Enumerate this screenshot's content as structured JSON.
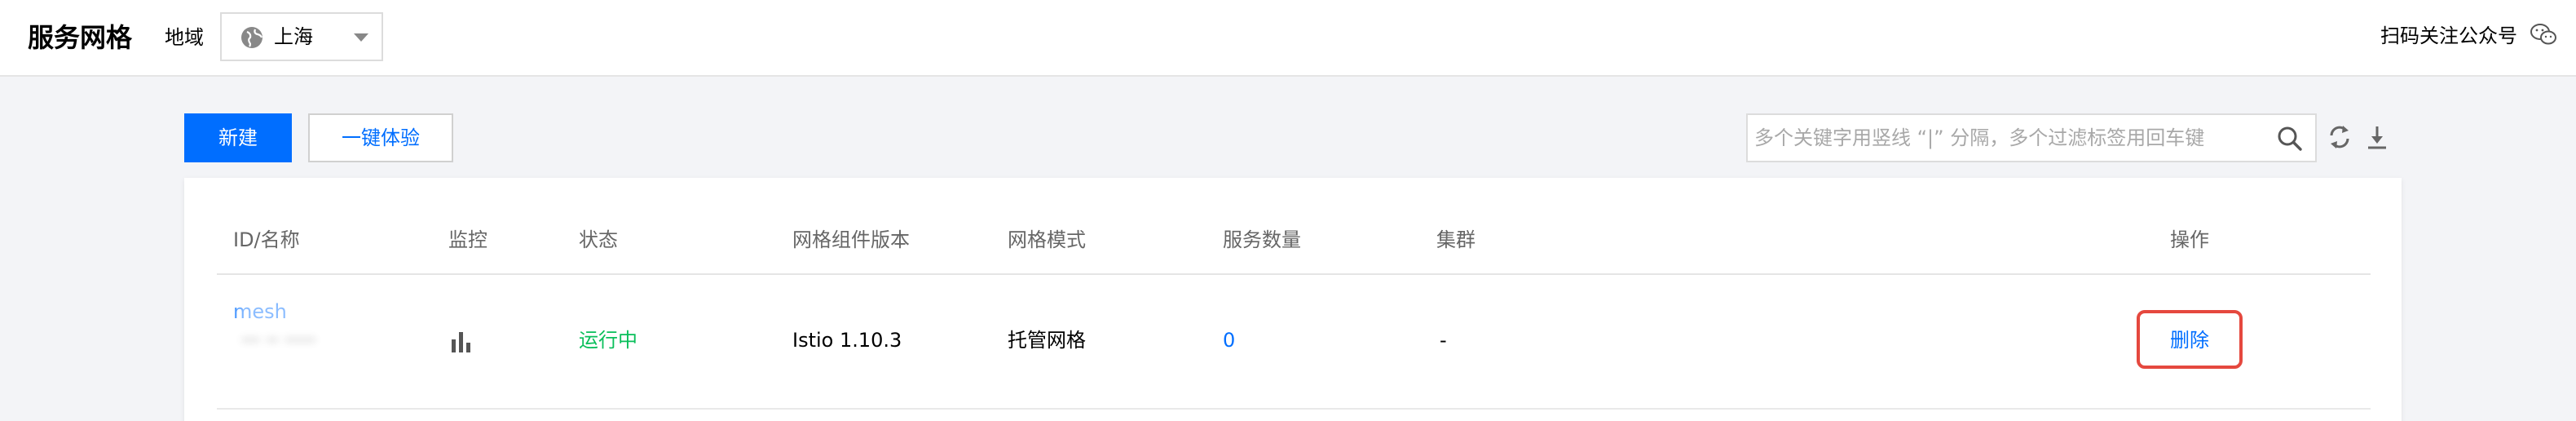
{
  "header": {
    "app_title": "服务网格",
    "region_label": "地域",
    "region_value": "上海",
    "follow_text": "扫码关注公众号"
  },
  "toolbar": {
    "new_label": "新建",
    "trial_label": "一键体验",
    "search_placeholder": "多个关键字用竖线 “|” 分隔，多个过滤标签用回车键",
    "search_value": ""
  },
  "table": {
    "columns": [
      "ID/名称",
      "监控",
      "状态",
      "网格组件版本",
      "网格模式",
      "服务数量",
      "集群",
      "操作"
    ],
    "rows": [
      {
        "id": "mesh",
        "name": "··· ·· ·····",
        "monitor_icon": "bar-chart-icon",
        "status": "运行中",
        "version": "Istio 1.10.3",
        "mode": "托管网格",
        "service_count": "0",
        "cluster": "-",
        "action": "删除"
      }
    ]
  },
  "colors": {
    "primary": "#006eff",
    "success": "#0abf5b",
    "highlight": "#e5483e",
    "background": "#f3f4f7"
  }
}
